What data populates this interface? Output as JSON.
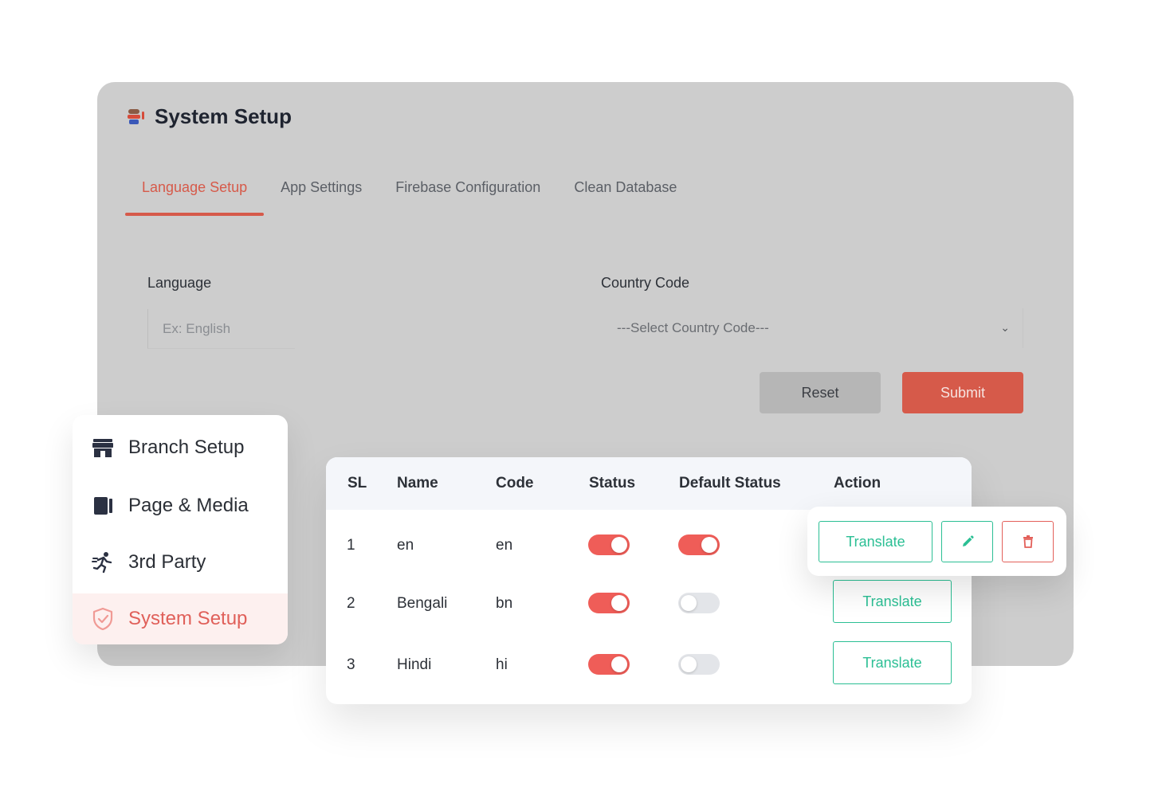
{
  "panel": {
    "title": "System Setup",
    "tabs": [
      {
        "label": "Language Setup",
        "active": true
      },
      {
        "label": "App Settings",
        "active": false
      },
      {
        "label": "Firebase Configuration",
        "active": false
      },
      {
        "label": "Clean Database",
        "active": false
      }
    ],
    "form": {
      "language_label": "Language",
      "language_placeholder": "Ex: English",
      "country_label": "Country Code",
      "country_select_value": "---Select Country Code---",
      "reset_label": "Reset",
      "submit_label": "Submit"
    }
  },
  "sidebar": {
    "items": [
      {
        "label": "Branch Setup",
        "icon": "store-icon",
        "active": false
      },
      {
        "label": "Page & Media",
        "icon": "book-icon",
        "active": false
      },
      {
        "label": "3rd Party",
        "icon": "runner-icon",
        "active": false
      },
      {
        "label": "System Setup",
        "icon": "shield-check-icon",
        "active": true
      }
    ]
  },
  "table": {
    "headers": {
      "sl": "SL",
      "name": "Name",
      "code": "Code",
      "status": "Status",
      "default_status": "Default Status",
      "action": "Action"
    },
    "rows": [
      {
        "sl": "1",
        "name": "en",
        "code": "en",
        "status": true,
        "default_status": true,
        "translate_label": "Translate"
      },
      {
        "sl": "2",
        "name": "Bengali",
        "code": "bn",
        "status": true,
        "default_status": false,
        "translate_label": "Translate"
      },
      {
        "sl": "3",
        "name": "Hindi",
        "code": "hi",
        "status": true,
        "default_status": false,
        "translate_label": "Translate"
      }
    ]
  },
  "action_card": {
    "translate_label": "Translate",
    "edit_icon": "pencil-icon",
    "delete_icon": "trash-icon"
  },
  "colors": {
    "accent": "#d65a4a",
    "toggle_on": "#ef5d58",
    "translate_green": "#2bbf94",
    "panel_bg": "#cdcdcd"
  }
}
